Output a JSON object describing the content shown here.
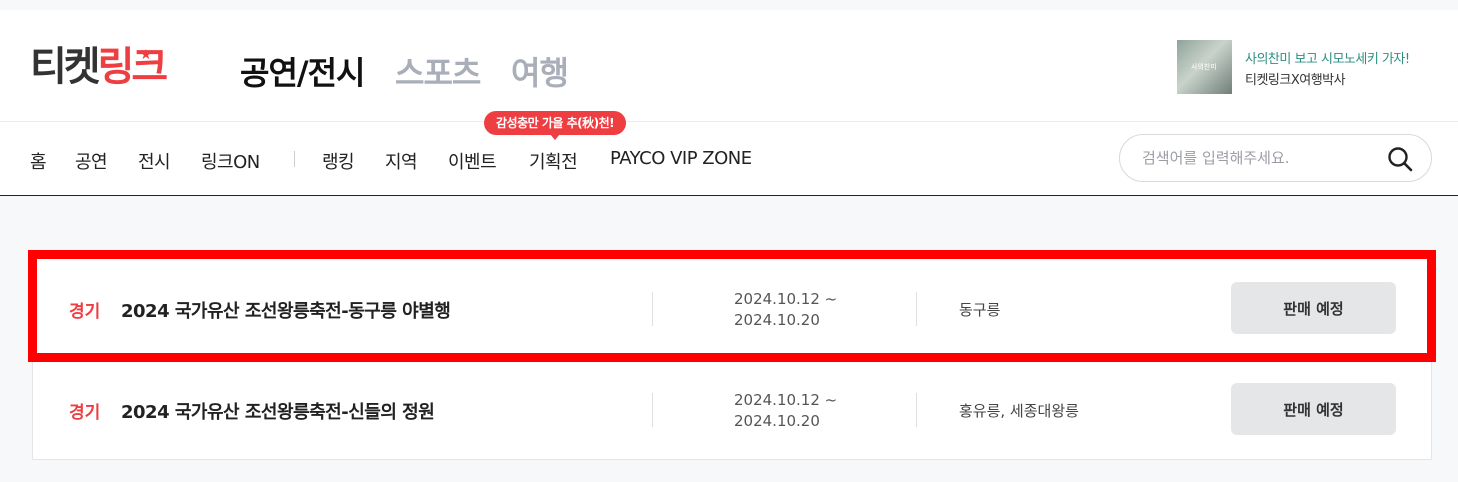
{
  "logo": {
    "part1": "티켓",
    "part2": "링크",
    "star": "★"
  },
  "categories": [
    "공연/전시",
    "스포츠",
    "여행"
  ],
  "promo": {
    "thumb_text": "사의찬미",
    "line1": "사의찬미 보고 시모노세키 가자!",
    "line2": "티켓링크X여행박사"
  },
  "nav": [
    "홈",
    "공연",
    "전시",
    "링크ON",
    "랭킹",
    "지역",
    "이벤트",
    "기획전",
    "PAYCO VIP ZONE"
  ],
  "bubble": "감성충만 가을 추(秋)천!",
  "search": {
    "placeholder": "검색어를 입력해주세요."
  },
  "events": [
    {
      "region": "경기",
      "title": "2024 국가유산 조선왕릉축전-동구릉 야별행",
      "date_start": "2024.10.12 ~",
      "date_end": "2024.10.20",
      "venue": "동구릉",
      "button": "판매 예정"
    },
    {
      "region": "경기",
      "title": "2024 국가유산 조선왕릉축전-신들의 정원",
      "date_start": "2024.10.12 ~",
      "date_end": "2024.10.20",
      "venue": "홍유릉, 세종대왕릉",
      "button": "판매 예정"
    }
  ],
  "colors": {
    "brand": "#ef3e42",
    "highlight": "#ff0000",
    "inactive_category": "#a9aeb8"
  }
}
